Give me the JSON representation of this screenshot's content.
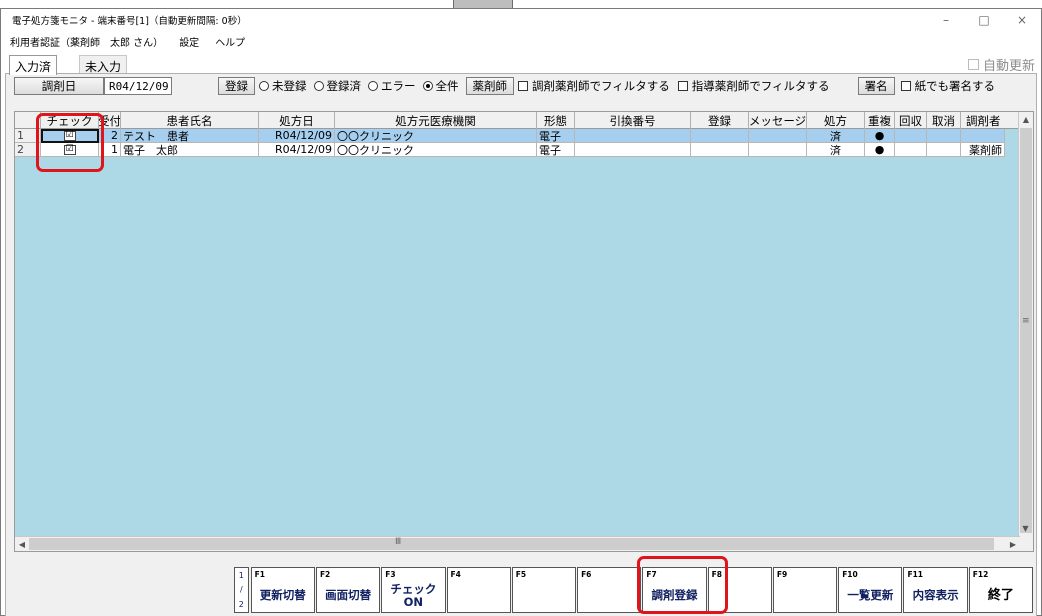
{
  "window": {
    "title": "電子処方箋モニタ - 端末番号[1]（自動更新間隔: 0秒）",
    "minimize": "–",
    "maximize": "□",
    "close": "×"
  },
  "menu": {
    "user": "利用者認証（薬剤師　太郎 さん）",
    "settings": "設定",
    "help": "ヘルプ"
  },
  "tabs": [
    {
      "label": "入力済"
    },
    {
      "label": "未入力"
    }
  ],
  "auto_update": {
    "label": "自動更新",
    "checked": false
  },
  "toolbar": {
    "date_button": "調剤日",
    "date_value": "R04/12/09",
    "register_button": "登録",
    "radios": [
      {
        "label": "未登録",
        "checked": false
      },
      {
        "label": "登録済",
        "checked": false
      },
      {
        "label": "エラー",
        "checked": false
      },
      {
        "label": "全件",
        "checked": true
      }
    ],
    "pharmacist_button": "薬剤師",
    "filter_dispensing": "調剤薬剤師でフィルタする",
    "filter_supervising": "指導薬剤師でフィルタする",
    "sign_button": "署名",
    "sign_paper": "紙でも署名する"
  },
  "table": {
    "columns": [
      "チェック",
      "受付",
      "患者氏名",
      "処方日",
      "処方元医療機関",
      "形態",
      "引換番号",
      "登録",
      "メッセージ",
      "処方",
      "重複",
      "回収",
      "取消",
      "調剤者"
    ],
    "rows": [
      {
        "num": "1",
        "check": "☑",
        "reception": "2",
        "patient": "テスト　患者",
        "date": "R04/12/09",
        "clinic": "〇〇クリニック",
        "form": "電子",
        "exchange": "",
        "registered": "",
        "message": "",
        "prescription": "済",
        "duplicate": "●",
        "recovered": "",
        "canceled": "",
        "dispenser": ""
      },
      {
        "num": "2",
        "check": "☑",
        "reception": "1",
        "patient": "電子　太郎",
        "date": "R04/12/09",
        "clinic": "〇〇クリニック",
        "form": "電子",
        "exchange": "",
        "registered": "",
        "message": "",
        "prescription": "済",
        "duplicate": "●",
        "recovered": "",
        "canceled": "",
        "dispenser": "薬剤師"
      }
    ]
  },
  "scroll": {
    "vthumb": "≡",
    "hthumb": "Ⅲ"
  },
  "pager": {
    "current": "1",
    "sep": "/",
    "total": "2"
  },
  "fkeys": [
    {
      "key": "F1",
      "label": "更新切替"
    },
    {
      "key": "F2",
      "label": "画面切替"
    },
    {
      "key": "F3",
      "label": "チェック\nON"
    },
    {
      "key": "F4",
      "label": ""
    },
    {
      "key": "F5",
      "label": ""
    },
    {
      "key": "F6",
      "label": ""
    },
    {
      "key": "F7",
      "label": "調剤登録"
    },
    {
      "key": "F8",
      "label": ""
    },
    {
      "key": "F9",
      "label": ""
    },
    {
      "key": "F10",
      "label": "一覧更新"
    },
    {
      "key": "F11",
      "label": "内容表示"
    },
    {
      "key": "F12",
      "label": "終了"
    }
  ],
  "highlight_color": "#e0141b",
  "selected_row_color": "#a6ceee",
  "grid_background": "#add8e6"
}
